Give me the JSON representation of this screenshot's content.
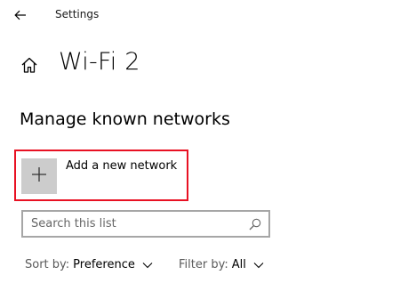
{
  "window": {
    "title": "Settings"
  },
  "page": {
    "title": "Wi-Fi 2"
  },
  "section": {
    "title": "Manage known networks"
  },
  "add_network": {
    "label": "Add a new network"
  },
  "search": {
    "placeholder": "Search this list",
    "value": ""
  },
  "sort": {
    "label": "Sort by:",
    "value": "Preference"
  },
  "filter": {
    "label": "Filter by:",
    "value": "All"
  },
  "colors": {
    "highlight_border": "#e81123",
    "add_tile": "#cccccc",
    "search_border": "#a6a6a6"
  },
  "icons": [
    "back-arrow-icon",
    "home-icon",
    "plus-icon",
    "search-icon",
    "chevron-down-icon"
  ]
}
